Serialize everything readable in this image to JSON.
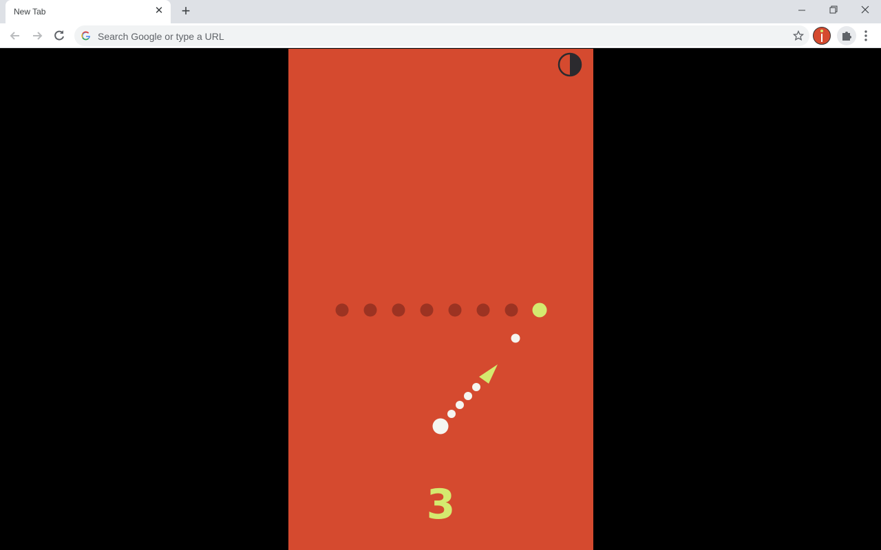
{
  "browser": {
    "tab_title": "New Tab",
    "omnibox_placeholder": "Search Google or type a URL",
    "icons": [
      "back-arrow-icon",
      "forward-arrow-icon",
      "reload-icon",
      "google-g-icon",
      "bookmark-star-icon",
      "profile-avatar",
      "extensions-puzzle-icon",
      "menu-kebab-icon",
      "minimize-icon",
      "restore-icon",
      "close-window-icon"
    ]
  },
  "game": {
    "score": "3",
    "targets_total": 8,
    "active_target_index": 7,
    "colors": {
      "background": "#d54a2f",
      "target_dim": "#9c3322",
      "target_active": "#d4ea6f",
      "ball": "#f5f5f0",
      "arrow": "#d4ea6f",
      "theme_toggle": "#2b2a2e"
    }
  }
}
